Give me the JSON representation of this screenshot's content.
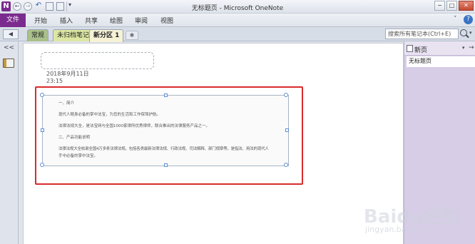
{
  "window": {
    "app_letter": "N",
    "title": "无标题页 - Microsoft OneNote",
    "minimize": "−",
    "maximize": "□",
    "close": "✕"
  },
  "quick_access": {
    "back": "←",
    "forward": "→",
    "undo": "↶",
    "customize": "▾"
  },
  "ribbon": {
    "file_tab": "文件",
    "tabs": [
      "开始",
      "插入",
      "共享",
      "绘图",
      "审阅",
      "视图"
    ],
    "caret": "˅",
    "help": "?"
  },
  "sections": {
    "nav": "◀",
    "tabs": [
      {
        "label": "常规",
        "color": "#a9c08a"
      },
      {
        "label": "未归档笔记",
        "color": "#dde7a3"
      },
      {
        "label": "新分区 1",
        "color": "#f5f2d6"
      }
    ],
    "add_tab": "✱"
  },
  "search": {
    "placeholder": "搜索所有笔记本(Ctrl+E)",
    "dropdown": "▾"
  },
  "left_pane": {
    "collapse": "<<"
  },
  "page": {
    "date": "2018年9月11日",
    "time": "23:15",
    "note_lines": [
      "一、简介",
      "现代人随身必备的掌中法宝，为您的生活和工作保驾护航。",
      "法律法规大全，是法宝网与全国1000家律所优秀律师，联合推出的法律服务产品之一。",
      "二、产品功能说明",
      "法律法规大全收录全国4万多条法律法规，包括各类最新法律法规、行政法规、司法解释、部门规章等，是指法、用法的现代人",
      "手中必备的掌中法宝。"
    ]
  },
  "page_list": {
    "new_page": "新页",
    "caret": "▾",
    "arrow": "→",
    "pages": [
      "无标题页"
    ]
  },
  "watermark": {
    "main": "Baidu经验",
    "sub": "jingyan.baidu.com"
  }
}
